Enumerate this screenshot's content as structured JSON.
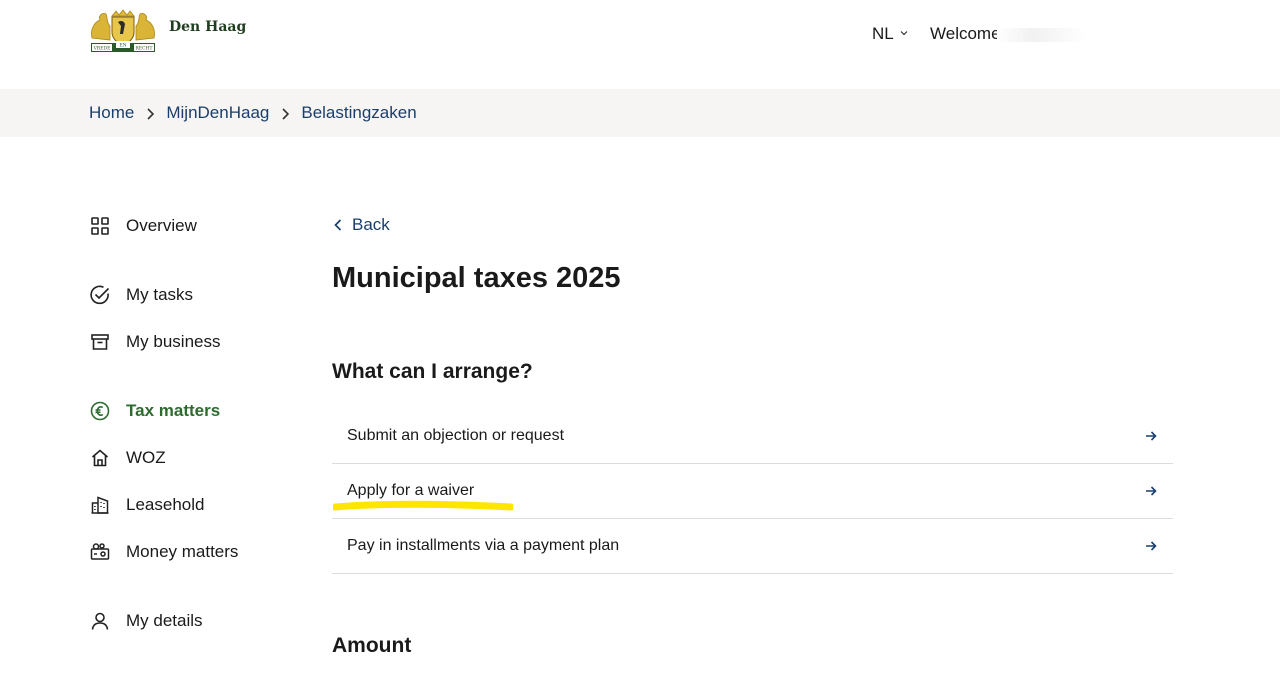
{
  "header": {
    "logo_text": "Den Haag",
    "logo_motto_left": "VREDE",
    "logo_motto_mid": "EN",
    "logo_motto_right": "RECHT",
    "language": "NL",
    "welcome_text": "Welcome"
  },
  "breadcrumb": [
    "Home",
    "MijnDenHaag",
    "Belastingzaken"
  ],
  "sidebar": {
    "items": [
      {
        "label": "Overview",
        "icon": "grid-icon"
      },
      {
        "label": "My tasks",
        "icon": "check-circle-icon"
      },
      {
        "label": "My business",
        "icon": "archive-box-icon"
      },
      {
        "label": "Tax matters",
        "icon": "euro-circle-icon",
        "active": true
      },
      {
        "label": "WOZ",
        "icon": "house-icon"
      },
      {
        "label": "Leasehold",
        "icon": "building-icon"
      },
      {
        "label": "Money matters",
        "icon": "wallet-icon"
      },
      {
        "label": "My details",
        "icon": "user-icon"
      }
    ]
  },
  "main": {
    "back_label": "Back",
    "title": "Municipal taxes 2025",
    "section_title": "What can I arrange?",
    "options": [
      {
        "label": "Submit an objection or request"
      },
      {
        "label": "Apply for a waiver"
      },
      {
        "label": "Pay in installments via a payment plan"
      }
    ],
    "amount_title": "Amount"
  },
  "colors": {
    "link_blue": "#1b3f6b",
    "active_green": "#2d6b2f",
    "crumb_bg": "#f6f5f3",
    "highlight_yellow": "#ffe600"
  }
}
